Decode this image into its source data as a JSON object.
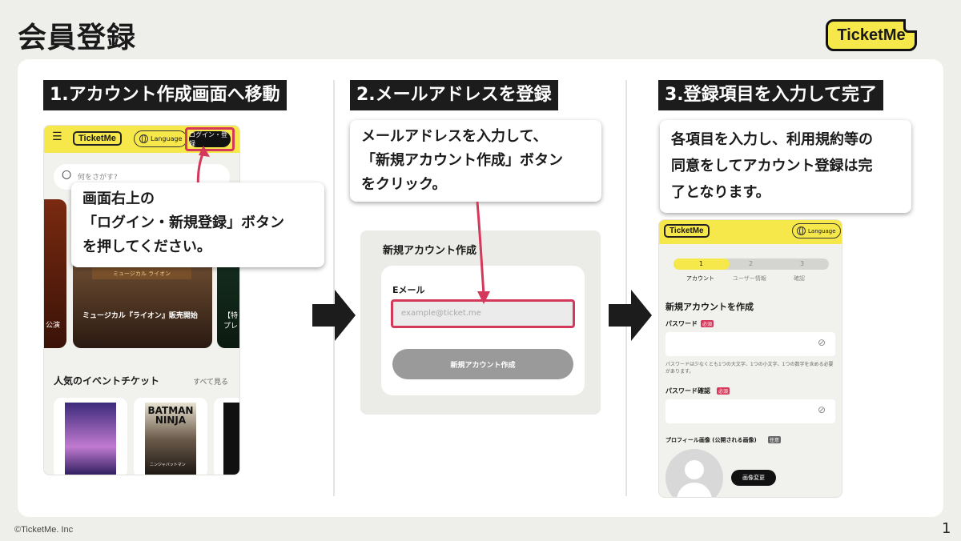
{
  "page": {
    "title": "会員登録",
    "brand": "TicketMe",
    "footer": "©TicketMe. Inc",
    "page_number": "1"
  },
  "colors": {
    "accent_yellow": "#f6e84a",
    "highlight_pink": "#d4385a",
    "dark": "#1c1c1c"
  },
  "step1": {
    "heading": "1.アカウント作成画面へ移動",
    "bubble_lines": [
      "画面右上の",
      "「ログイン・新規登録」ボタン",
      "を押してください。"
    ],
    "phone": {
      "logo": "TicketMe",
      "language": "Language",
      "login_button": "ログイン・登録",
      "search_placeholder": "何をさがす?",
      "banner_left": "公演",
      "banner_center": "ミュージカル『ライオン』販売開始",
      "banner_center_poster": "ミュージカル ライオン",
      "banner_right": "【特\nプレ",
      "section_title": "人気のイベントチケット",
      "see_all": "すべて見る",
      "poster2_title": "BATMAN NINJA",
      "poster2_sub": "ニンジャバットマン"
    }
  },
  "step2": {
    "heading": "2.メールアドレスを登録",
    "bubble_lines": [
      "メールアドレスを入力して、",
      "「新規アカウント作成」ボタン",
      "をクリック。"
    ],
    "form": {
      "title": "新規アカウント作成",
      "email_label": "Eメール",
      "email_placeholder": "example@ticket.me",
      "submit": "新規アカウント作成"
    }
  },
  "step3": {
    "heading": "3.登録項目を入力して完了",
    "bubble_lines": [
      "各項目を入力し、利用規約等の",
      "同意をしてアカウント登録は完",
      "了となります。"
    ],
    "phone": {
      "logo": "TicketMe",
      "language": "Language",
      "steps": [
        {
          "num": "1",
          "label": "アカウント"
        },
        {
          "num": "2",
          "label": "ユーザー情報"
        },
        {
          "num": "3",
          "label": "確認"
        }
      ],
      "form_title": "新規アカウントを作成",
      "password_label": "パスワード",
      "required": "必須",
      "password_hint": "パスワードは少なくとも1つの大文字、1つの小文字、1つの数字を含める必要があります。",
      "confirm_label": "パスワード確認",
      "profile_label": "プロフィール画像 (公開される画像)",
      "optional": "任意",
      "change_image": "画像変更"
    }
  }
}
